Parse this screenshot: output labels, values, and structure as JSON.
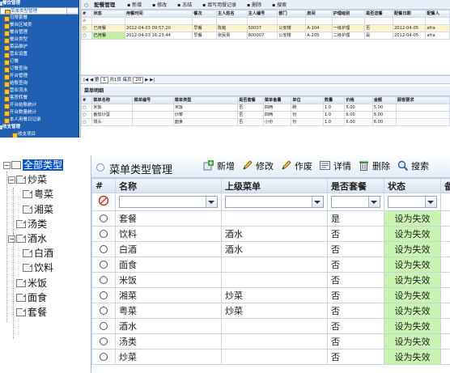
{
  "top": {
    "nav_groups": [
      {
        "label": "餐饮管理",
        "items": [
          "菜单类型管理",
          "日常套餐",
          "餐台区域类",
          "餐台管理",
          "餐台类型",
          "菜品维护",
          "营业设置",
          "订餐",
          "订餐查询",
          "开台管理",
          "结账查询",
          "营业流水",
          "客房转餐",
          "开台结账统计",
          "开台数量统计",
          "本人用餐日记录"
        ]
      },
      {
        "label": "收支管理",
        "items": [
          "收支项目",
          "收支记录"
        ]
      },
      {
        "label": "库存管理",
        "items": []
      }
    ],
    "title": "配餐管理",
    "toolbar": [
      "新增",
      "修改",
      "冻结",
      "填写用餐记录",
      "删除",
      "搜索"
    ],
    "columns": [
      "#",
      "状态",
      "用餐时间",
      "餐次",
      "主人姓名",
      "主人编号",
      "部门",
      "房间",
      "护理级别",
      "是否送餐",
      "配餐日期",
      "配餐人"
    ],
    "rows": [
      [
        "",
        "已用餐",
        "2012-04-03 09:57:20",
        "早餐",
        "陈勉",
        "50007",
        "公安楼",
        "A-104",
        "一级护理",
        "否",
        "2012-04-05",
        "afra"
      ],
      [
        "",
        "已用餐",
        "2012-04-03 16:23:44",
        "早餐",
        "张民贵",
        "800007",
        "公安楼",
        "A-205",
        "二级护理",
        "是",
        "2012-04-05",
        "afra"
      ]
    ],
    "pager": {
      "page_prefix": "第",
      "page": "1",
      "page_suffix": "共1页",
      "per_page_prefix": "每页",
      "per_page": "20"
    },
    "detail_title": "菜单明细",
    "detail_columns": [
      "#",
      "菜单名称",
      "菜单编号",
      "菜单类型",
      "是否套餐",
      "菜单备量",
      "单位",
      "数量",
      "价格",
      "金额",
      "顾客要求"
    ],
    "detail_rows": [
      [
        "",
        "米饭",
        "",
        "米饭",
        "否",
        "四两",
        "碗",
        "1.0",
        "5.00",
        "5.00",
        ""
      ],
      [
        "",
        "番茄炒蛋",
        "",
        "炒菜",
        "否",
        "四两",
        "份",
        "1.0",
        "6.00",
        "6.00",
        ""
      ],
      [
        "",
        "馒头",
        "",
        "面食",
        "否",
        "小份",
        "份",
        "1.0",
        "6.00",
        "6.00",
        ""
      ]
    ]
  },
  "tree": {
    "root": "全部类型",
    "nodes": [
      {
        "label": "炒菜",
        "level": 1,
        "expanded": true
      },
      {
        "label": "粤菜",
        "level": 2
      },
      {
        "label": "湘菜",
        "level": 2
      },
      {
        "label": "汤类",
        "level": 1
      },
      {
        "label": "酒水",
        "level": 1,
        "expanded": true
      },
      {
        "label": "白酒",
        "level": 2
      },
      {
        "label": "饮料",
        "level": 2
      },
      {
        "label": "米饭",
        "level": 1
      },
      {
        "label": "面食",
        "level": 1
      },
      {
        "label": "套餐",
        "level": 1
      }
    ]
  },
  "panel": {
    "title": "菜单类型管理",
    "toolbar": {
      "add": "新增",
      "edit": "修改",
      "void": "作废",
      "detail": "详情",
      "delete": "删除",
      "search": "搜索"
    },
    "columns": [
      "#",
      "名称",
      "上级菜单",
      "是否套餐",
      "状态",
      "备"
    ],
    "status_action": "设为失效",
    "rows": [
      {
        "name": "套餐",
        "parent": "",
        "combo": "是"
      },
      {
        "name": "饮料",
        "parent": "酒水",
        "combo": "否"
      },
      {
        "name": "白酒",
        "parent": "酒水",
        "combo": "否"
      },
      {
        "name": "面食",
        "parent": "",
        "combo": "否"
      },
      {
        "name": "米饭",
        "parent": "",
        "combo": "否"
      },
      {
        "name": "湘菜",
        "parent": "炒菜",
        "combo": "否"
      },
      {
        "name": "粤菜",
        "parent": "炒菜",
        "combo": "否"
      },
      {
        "name": "酒水",
        "parent": "",
        "combo": "否"
      },
      {
        "name": "汤类",
        "parent": "",
        "combo": "否"
      },
      {
        "name": "炒菜",
        "parent": "",
        "combo": "否"
      }
    ]
  },
  "colors": {
    "nav_bg": "#1f5fb2",
    "status_green": "#c8f4b0",
    "header_bg": "#d6e1f0"
  }
}
